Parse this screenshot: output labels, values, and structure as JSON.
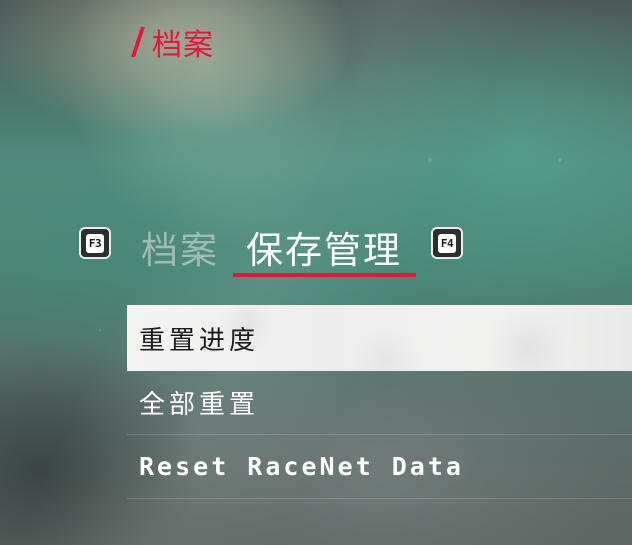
{
  "page": {
    "title": "档案",
    "accent_color": "#e8143c"
  },
  "tabs": {
    "prev_key": "F3",
    "next_key": "F4",
    "items": [
      {
        "label": "档案",
        "active": false
      },
      {
        "label": "保存管理",
        "active": true
      }
    ]
  },
  "menu": {
    "items": [
      {
        "label": "重置进度",
        "selected": true
      },
      {
        "label": "全部重置",
        "selected": false
      },
      {
        "label": "Reset RaceNet Data",
        "selected": false
      }
    ]
  }
}
